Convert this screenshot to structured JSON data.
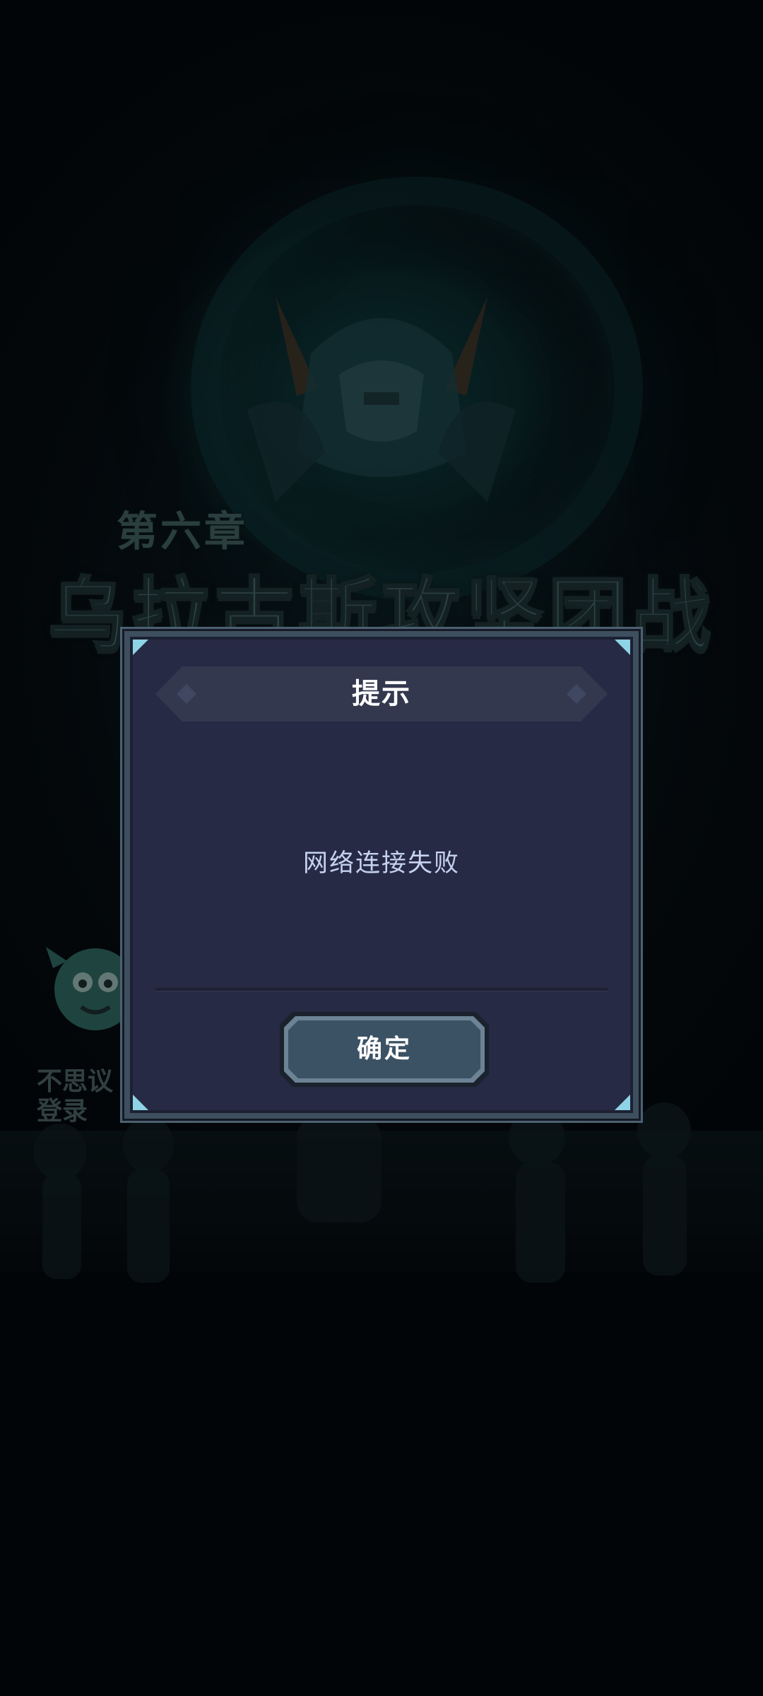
{
  "background": {
    "chapter_label": "第六章",
    "chapter_title": "乌拉古斯攻坚团战",
    "mascot_lines": [
      "不思议",
      "登录"
    ]
  },
  "dialog": {
    "title": "提示",
    "message": "网络连接失败",
    "confirm_label": "确定"
  },
  "colors": {
    "dialog_bg": "#272a44",
    "dialog_border": "#3e4f5f",
    "button_fill": "#3b5264",
    "message_text": "#c6d2f0"
  }
}
